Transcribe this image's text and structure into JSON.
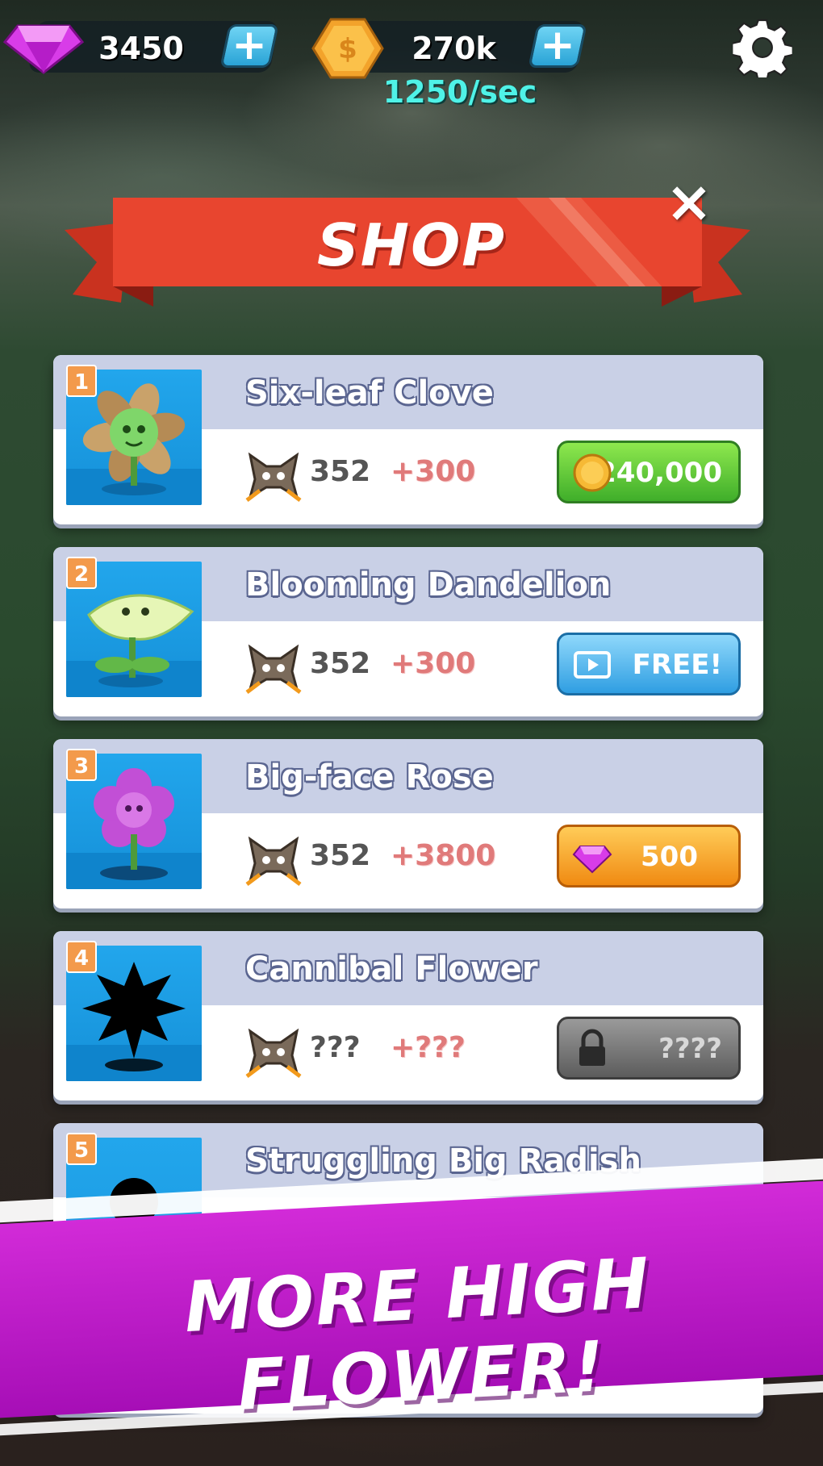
{
  "hud": {
    "gems": "3450",
    "coins": "270k",
    "rate": "1250/sec"
  },
  "shop": {
    "title": "SHOP",
    "items": [
      {
        "number": "1",
        "name": "Six-leaf Clove",
        "stat": "352",
        "bonus": "+300",
        "price": "240,000",
        "price_type": "coin"
      },
      {
        "number": "2",
        "name": "Blooming Dandelion",
        "stat": "352",
        "bonus": "+300",
        "price": "FREE!",
        "price_type": "video"
      },
      {
        "number": "3",
        "name": "Big-face Rose",
        "stat": "352",
        "bonus": "+3800",
        "price": "500",
        "price_type": "gem"
      },
      {
        "number": "4",
        "name": "Cannibal Flower",
        "stat": "???",
        "bonus": "+???",
        "price": "????",
        "price_type": "locked"
      },
      {
        "number": "5",
        "name": "Struggling Big Radish"
      }
    ]
  },
  "promo": {
    "text": "MORE HIGH FLOWER!"
  },
  "colors": {
    "ribbon": "#e8452f",
    "promo": "#c11fd0",
    "rate": "#4ff2e7"
  }
}
